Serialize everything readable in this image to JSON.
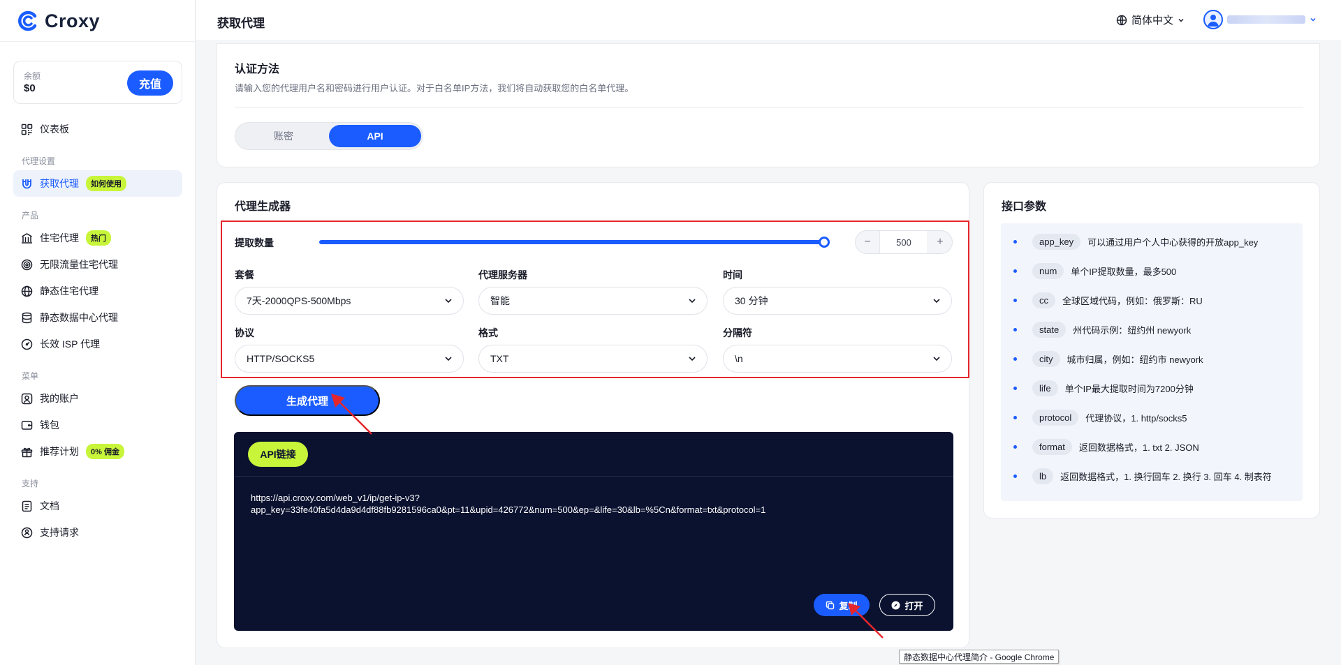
{
  "brand": {
    "name": "Croxy"
  },
  "balance": {
    "label": "余额",
    "value": "$0",
    "recharge": "充值"
  },
  "nav": {
    "dashboard": "仪表板",
    "section_proxy": "代理设置",
    "get_proxy": "获取代理",
    "get_proxy_badge": "如何使用",
    "section_products": "产品",
    "residential": "住宅代理",
    "residential_badge": "热门",
    "unlimited": "无限流量住宅代理",
    "static_residential": "静态住宅代理",
    "static_datacenter": "静态数据中心代理",
    "long_isp": "长效 ISP 代理",
    "section_menu": "菜单",
    "account": "我的账户",
    "wallet": "钱包",
    "referral": "推荐计划",
    "referral_badge": "0% 佣金",
    "section_support": "支持",
    "docs": "文档",
    "support": "支持请求"
  },
  "header": {
    "title": "获取代理",
    "language": "简体中文"
  },
  "auth": {
    "title": "认证方法",
    "description": "请输入您的代理用户名和密码进行用户认证。对于白名单IP方法，我们将自动获取您的白名单代理。",
    "tab_account": "账密",
    "tab_api": "API",
    "active_tab": "API"
  },
  "generator": {
    "title": "代理生成器",
    "quantity_label": "提取数量",
    "quantity_value": "500",
    "quantity_fraction": 1.0,
    "plan_label": "套餐",
    "plan_value": "7天-2000QPS-500Mbps",
    "server_label": "代理服务器",
    "server_value": "智能",
    "time_label": "时间",
    "time_value": "30 分钟",
    "protocol_label": "协议",
    "protocol_value": "HTTP/SOCKS5",
    "format_label": "格式",
    "format_value": "TXT",
    "separator_label": "分隔符",
    "separator_value": "\\n",
    "generate_button": "生成代理"
  },
  "api": {
    "badge": "API链接",
    "url_line1": "https://api.croxy.com/web_v1/ip/get-ip-v3?",
    "url_line2": "app_key=33fe40fa5d4da9d4df88fb9281596ca0&pt=11&upid=426772&num=500&ep=&life=30&lb=%5Cn&format=txt&protocol=1",
    "copy": "复制",
    "open": "打开"
  },
  "params": {
    "title": "接口参数",
    "items": [
      {
        "key": "app_key",
        "desc": "可以通过用户个人中心获得的开放app_key"
      },
      {
        "key": "num",
        "desc": "单个IP提取数量，最多500"
      },
      {
        "key": "cc",
        "desc": "全球区域代码，例如：俄罗斯：RU"
      },
      {
        "key": "state",
        "desc": "州代码示例：纽约州 newyork"
      },
      {
        "key": "city",
        "desc": "城市归属，例如：纽约市 newyork"
      },
      {
        "key": "life",
        "desc": "单个IP最大提取时间为7200分钟"
      },
      {
        "key": "protocol",
        "desc": "代理协议，1. http/socks5"
      },
      {
        "key": "format",
        "desc": "返回数据格式，1. txt 2. JSON"
      },
      {
        "key": "lb",
        "desc": "返回数据格式，1. 换行回车 2. 换行 3. 回车 4. 制表符"
      }
    ]
  },
  "tooltip": "静态数据中心代理简介 - Google Chrome",
  "colors": {
    "primary": "#1a5cff",
    "accent": "#c8f53a",
    "dark": "#0b1230",
    "annotation": "#e5262c"
  }
}
